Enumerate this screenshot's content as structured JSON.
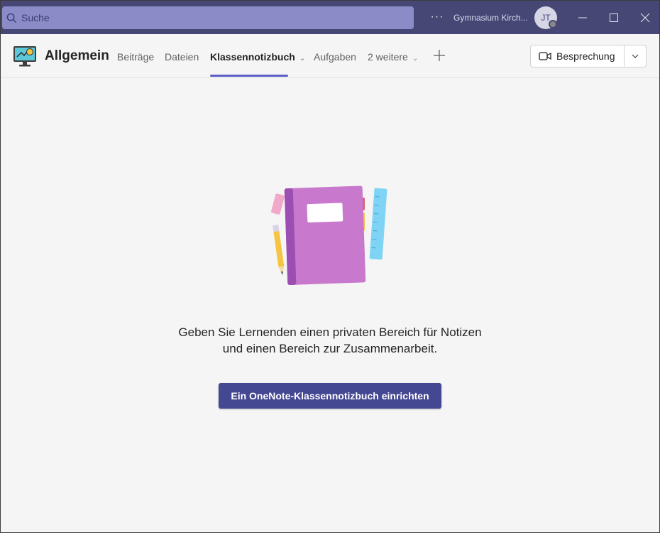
{
  "titlebar": {
    "search_placeholder": "Suche",
    "more_label": "···",
    "org_name": "Gymnasium Kirch...",
    "avatar_initials": "JT",
    "colors": {
      "background": "#464775",
      "search": "#8b8cc7"
    }
  },
  "header": {
    "channel_name": "Allgemein",
    "tabs": [
      {
        "label": "Beiträge"
      },
      {
        "label": "Dateien"
      },
      {
        "label": "Klassennotizbuch",
        "active": true
      },
      {
        "label": "Aufgaben"
      },
      {
        "label": "2 weitere"
      }
    ],
    "meeting_label": "Besprechung",
    "accent": "#5b5fc7"
  },
  "main": {
    "description_line1": "Geben Sie Lernenden einen privaten Bereich für Notizen",
    "description_line2": "und einen Bereich zur Zusammenarbeit.",
    "setup_button": "Ein OneNote-Klassennotizbuch einrichten",
    "button_color": "#444791"
  },
  "icons": [
    "search-icon",
    "more-icon",
    "minimize-icon",
    "maximize-icon",
    "close-icon",
    "chevron-down-icon",
    "plus-icon",
    "video-camera-icon",
    "notebook-illustration"
  ]
}
